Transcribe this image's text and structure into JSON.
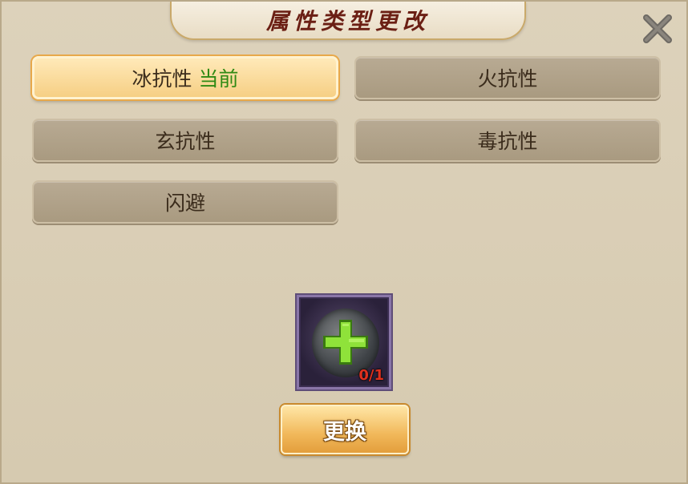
{
  "dialog": {
    "title": "属性类型更改",
    "close_icon": "close-icon"
  },
  "options": [
    {
      "label": "冰抗性",
      "status": "当前",
      "selected": true
    },
    {
      "label": "火抗性",
      "status": "",
      "selected": false
    },
    {
      "label": "玄抗性",
      "status": "",
      "selected": false
    },
    {
      "label": "毒抗性",
      "status": "",
      "selected": false
    },
    {
      "label": "闪避",
      "status": "",
      "selected": false
    }
  ],
  "item_slot": {
    "icon": "plus-icon",
    "count": "0/1"
  },
  "swap_button": {
    "label": "更换"
  },
  "colors": {
    "current_status": "#2f8a14",
    "title": "#6b1f14",
    "count": "#e0301e"
  }
}
